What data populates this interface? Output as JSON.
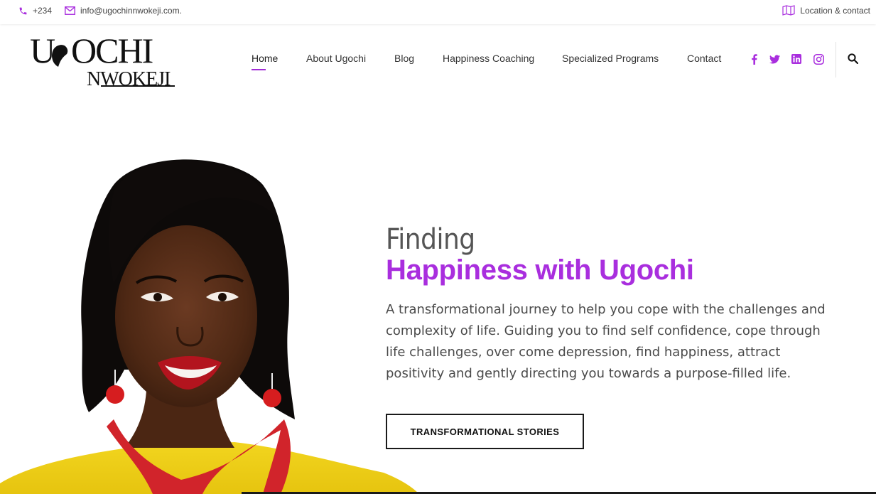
{
  "topbar": {
    "phone": "+234",
    "email": "info@ugochinnwokeji.com.",
    "location": "Location & contact"
  },
  "logo": {
    "line1": "UGOCHI",
    "line2": "NWOKEJI"
  },
  "nav": {
    "items": [
      {
        "label": "Home"
      },
      {
        "label": "About Ugochi"
      },
      {
        "label": "Blog"
      },
      {
        "label": "Happiness Coaching"
      },
      {
        "label": "Specialized Programs"
      },
      {
        "label": "Contact"
      }
    ],
    "active": "Home"
  },
  "social": [
    "facebook-icon",
    "twitter-icon",
    "linkedin-icon",
    "instagram-icon"
  ],
  "hero": {
    "pre_title": "Finding",
    "title": "Happiness with Ugochi",
    "description": "A transformational journey to help you cope with the challenges and complexity of life. Guiding you to find self confidence, cope through life challenges, over come depression, find happiness, attract positivity and gently directing you towards a purpose-filled life.",
    "cta": "TRANSFORMATIONAL STORIES"
  },
  "colors": {
    "accent": "#a92ede",
    "text": "#4a4a4a",
    "dark": "#1a1a1a"
  }
}
